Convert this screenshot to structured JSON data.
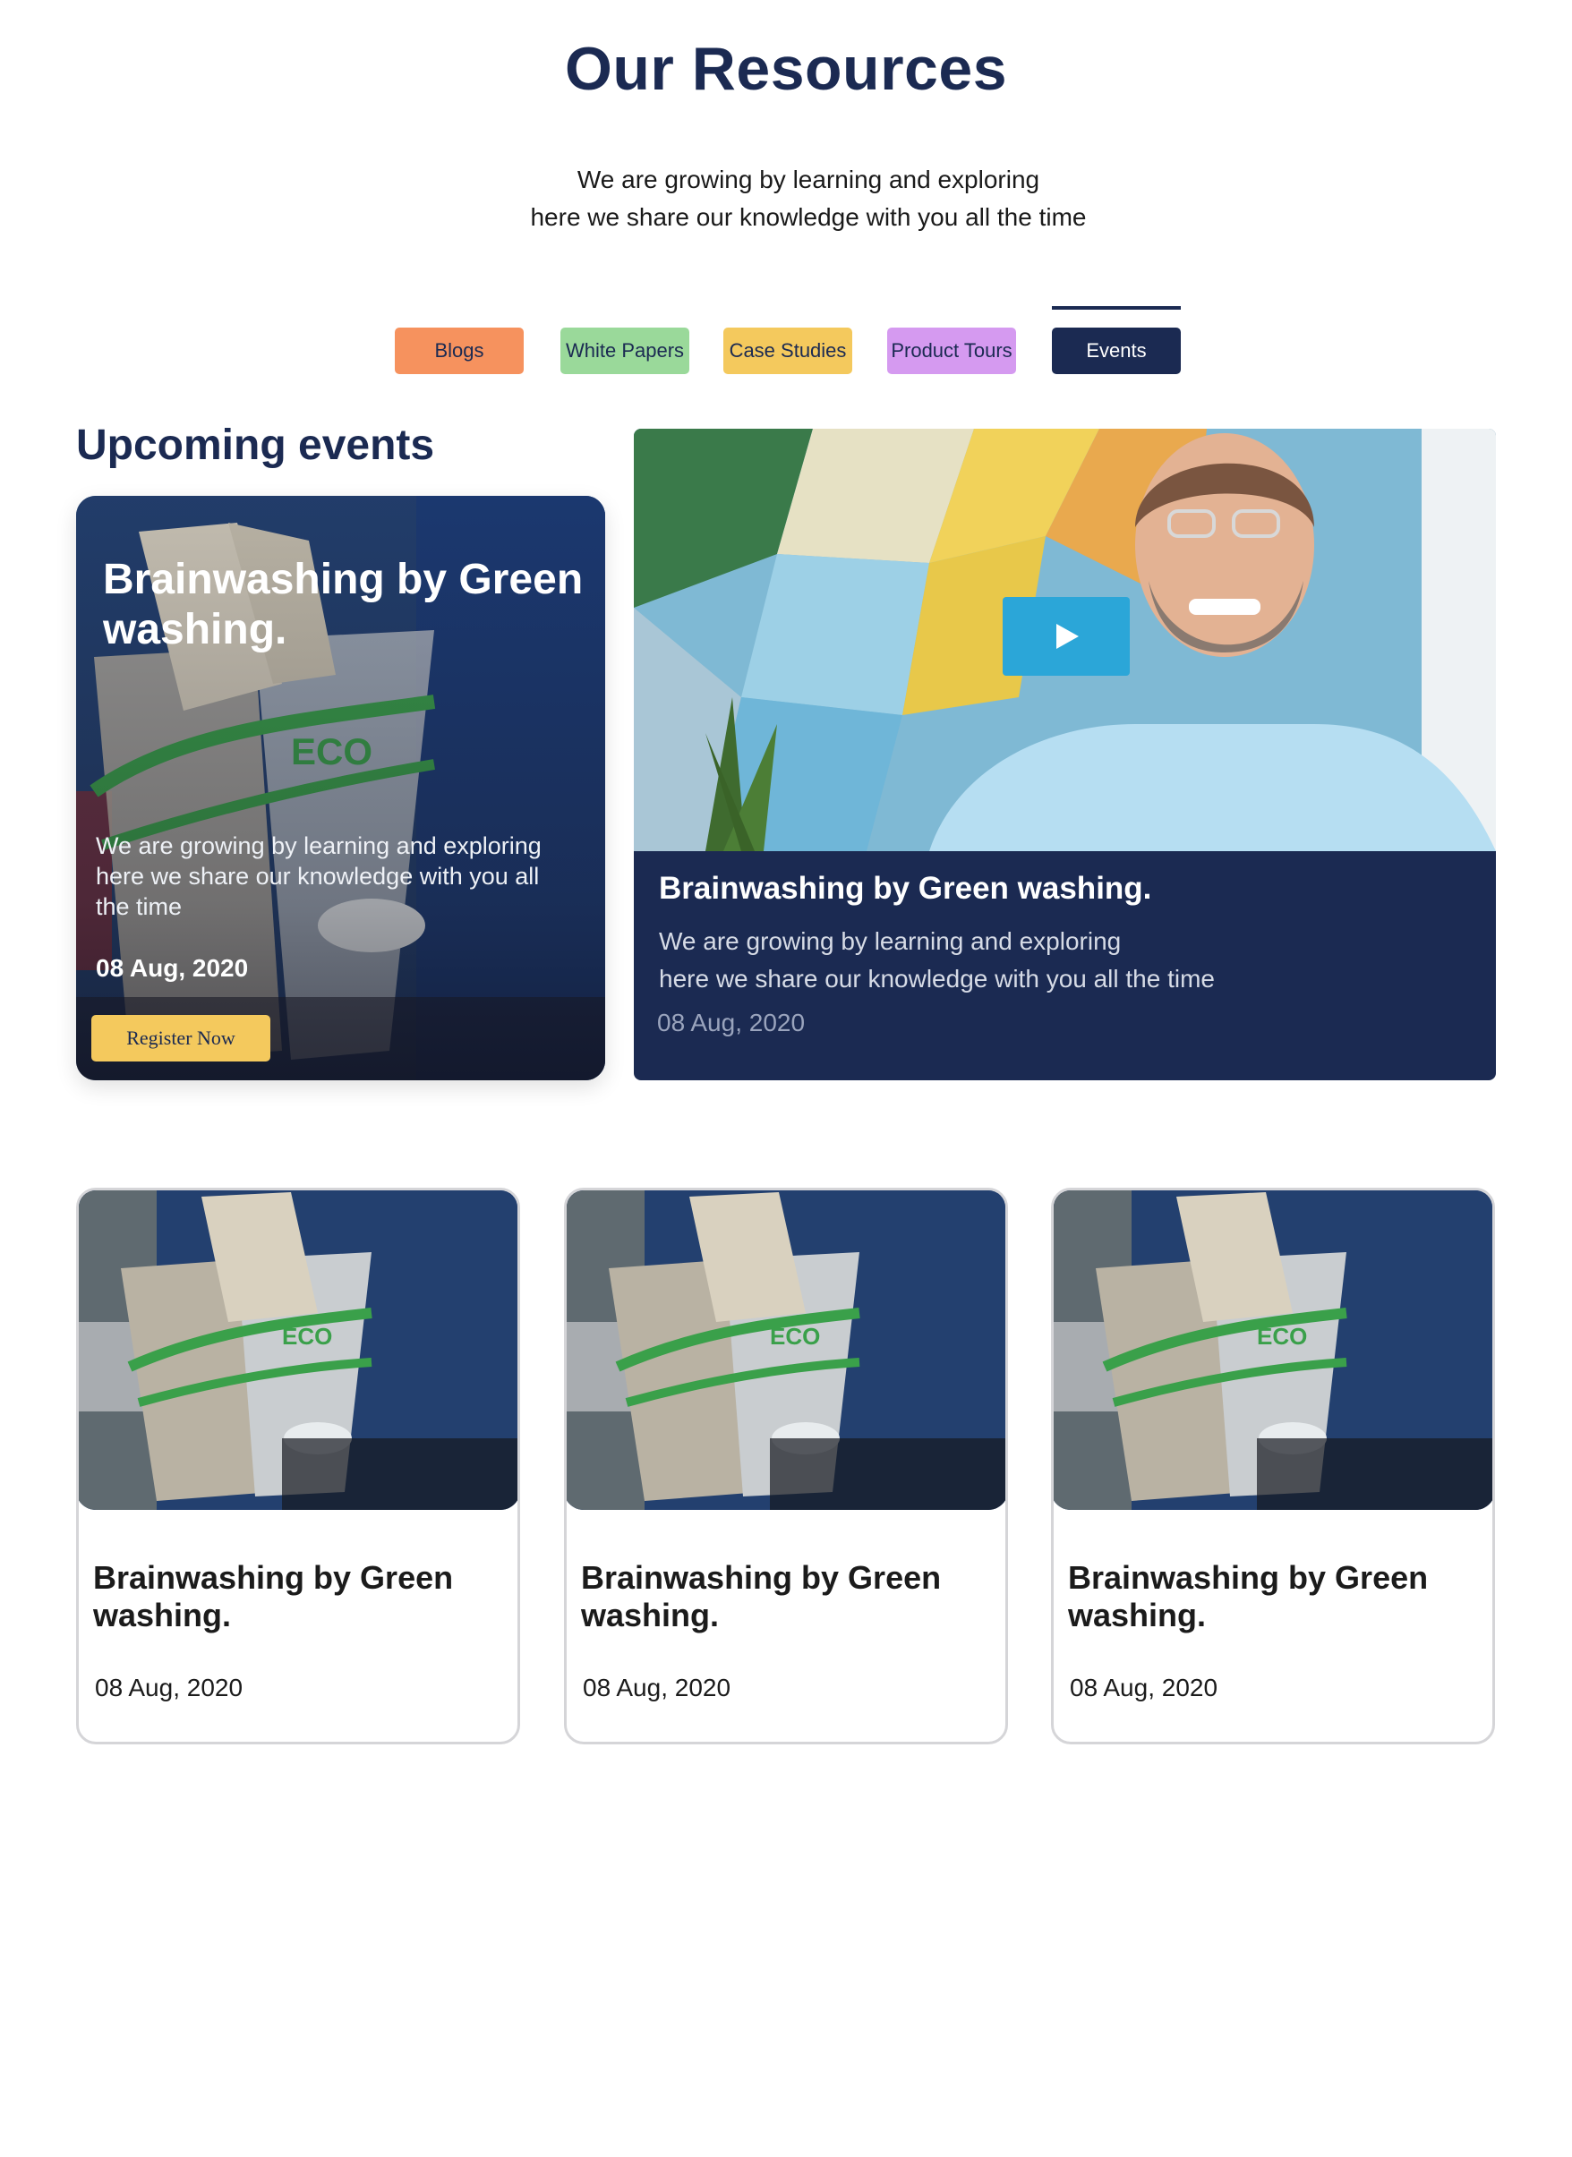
{
  "header": {
    "title": "Our Resources",
    "subtitle_line1": "We are growing by learning and exploring",
    "subtitle_line2": "here we share our knowledge with you all the time"
  },
  "tabs": [
    {
      "label": "Blogs",
      "color": "#f6925e",
      "active": false
    },
    {
      "label": "White Papers",
      "color": "#9ad99a",
      "active": false
    },
    {
      "label": "Case Studies",
      "color": "#f4c95d",
      "active": false
    },
    {
      "label": "Product Tours",
      "color": "#d59af0",
      "active": false
    },
    {
      "label": "Events",
      "color": "#1b2a52",
      "active": true
    }
  ],
  "section": {
    "title": "Upcoming events"
  },
  "featured": {
    "title": "Brainwashing by Green washing.",
    "description": "We are growing by learning and exploring here we share our knowledge with you all the time",
    "date": "08 Aug, 2020",
    "register_label": "Register Now"
  },
  "video": {
    "title": "Brainwashing by Green washing.",
    "desc_line1": "We are growing by learning and exploring",
    "desc_line2": "here we share our knowledge with you all the time",
    "date": "08 Aug, 2020",
    "play_icon": "play-icon"
  },
  "events": [
    {
      "title": "Brainwashing by Green washing.",
      "date": "08 Aug, 2020"
    },
    {
      "title": "Brainwashing by Green washing.",
      "date": "08 Aug, 2020"
    },
    {
      "title": "Brainwashing by Green washing.",
      "date": "08 Aug, 2020"
    }
  ],
  "colors": {
    "navy": "#1b2a52",
    "accent_yellow": "#f4c95d",
    "video_play": "#2ba6d8"
  }
}
